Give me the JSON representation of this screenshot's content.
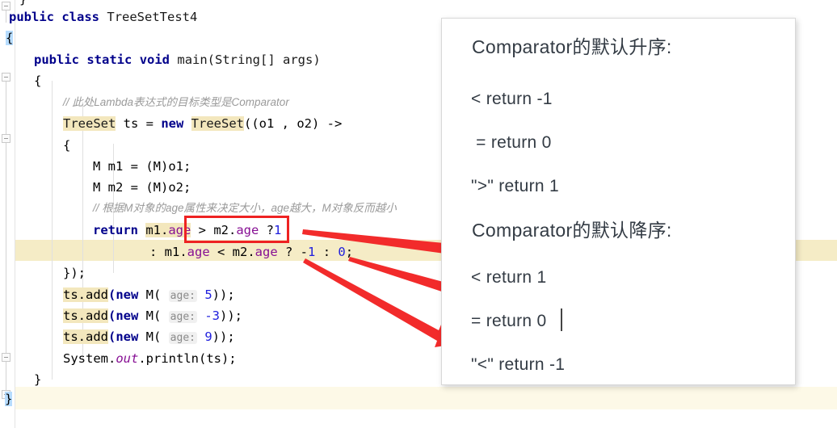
{
  "editor": {
    "language": "java",
    "lines": [
      {
        "text": "}",
        "kind": "tail"
      },
      {
        "text": "public class TreeSetTest4",
        "kind": "code"
      },
      {
        "text": "{",
        "kind": "code"
      },
      {
        "text": "public static void main(String[] args)",
        "kind": "code"
      },
      {
        "text": "{",
        "kind": "code"
      },
      {
        "text": "// 此处Lambda表达式的目标类型是Comparator",
        "kind": "comment"
      },
      {
        "text": "TreeSet ts = new TreeSet((o1 , o2) ->",
        "kind": "code"
      },
      {
        "text": "{",
        "kind": "code"
      },
      {
        "text": "M m1 = (M)o1;",
        "kind": "code"
      },
      {
        "text": "M m2 = (M)o2;",
        "kind": "code"
      },
      {
        "text": "// 根据M对象的age属性来决定大小，age越大，M对象反而越小",
        "kind": "comment"
      },
      {
        "text": "return m1.age > m2.age ?1",
        "kind": "code"
      },
      {
        "text": ": m1.age < m2.age ? -1 : 0;",
        "kind": "code"
      },
      {
        "text": "});",
        "kind": "code"
      },
      {
        "text": "ts.add(new M( age: 5));",
        "kind": "code"
      },
      {
        "text": "ts.add(new M( age: -3));",
        "kind": "code"
      },
      {
        "text": "ts.add(new M( age: 9));",
        "kind": "code"
      },
      {
        "text": "System.out.println(ts);",
        "kind": "code"
      },
      {
        "text": "}",
        "kind": "code"
      },
      {
        "text": "}",
        "kind": "code"
      }
    ],
    "tokens": {
      "k_public": "public",
      "k_class": "class",
      "k_static": "static",
      "k_void": "void",
      "k_new": "new",
      "k_return": "return",
      "t_TreeSetTest4": "TreeSetTest4",
      "t_main": "main(String[] args)",
      "t_TreeSet": "TreeSet",
      "t_ts": " ts = ",
      "t_treeset_call": "((o1 , o2) ->",
      "t_m1decl": "M m1 = (M)o1;",
      "t_m2decl": "M m2 = (M)o2;",
      "t_ret_expr_a": "m1.",
      "t_age": "age",
      "t_ret_expr_b": " > m2.",
      "t_ret_expr_c": " ?",
      "t_one": "1",
      "t_cont_a": ": m1.",
      "t_cont_b": " < m2.",
      "t_cont_c": " ? ",
      "t_minus": "-",
      "t_cont_d": " : ",
      "t_zero": "0",
      "t_semi": ";",
      "t_closeLambda": "});",
      "t_tsadd": "ts.add",
      "t_open": "(",
      "t_mopen": " M( ",
      "t_hint": "age:",
      "t_v5": "5",
      "t_vneg3": "-3",
      "t_v9": "9",
      "t_close2": "));",
      "t_system": "System.",
      "t_out": "out",
      "t_println": ".println(ts);",
      "t_brace_open": "{",
      "t_brace_close": "}"
    },
    "comments": {
      "line6": "// 此处Lambda表达式的目标类型是Comparator",
      "line11": "// 根据M对象的age属性来决定大小，age越大，M对象反而越小"
    },
    "colors": {
      "keyword": "#00008b",
      "number": "#2020dd",
      "field": "#871094",
      "comment": "#9a9a9a",
      "usage_highlight": "#f3e7bd",
      "caret_row": "#fdf9e7",
      "selected_row": "#f5ecc6",
      "brace_match": "#b6dcfe",
      "annotation_red": "#ee2222"
    }
  },
  "annotation_panel": {
    "lines": [
      "Comparator的默认升序:",
      "< return -1",
      " = return 0",
      "\">\" return 1",
      "Comparator的默认降序:",
      "< return 1",
      "= return 0",
      "\"<\" return -1"
    ],
    "ascending_title": "Comparator的默认升序:",
    "descending_title": "Comparator的默认降序:",
    "ascending_rules": [
      "< return -1",
      " = return 0",
      "\">\" return 1"
    ],
    "descending_rules": [
      "< return 1",
      "= return 0",
      "\"<\" return -1"
    ]
  },
  "arrows": {
    "count": 3,
    "color": "#f22b2b",
    "targets": [
      "< return 1",
      "= return 0",
      "\"<\" return -1"
    ]
  }
}
